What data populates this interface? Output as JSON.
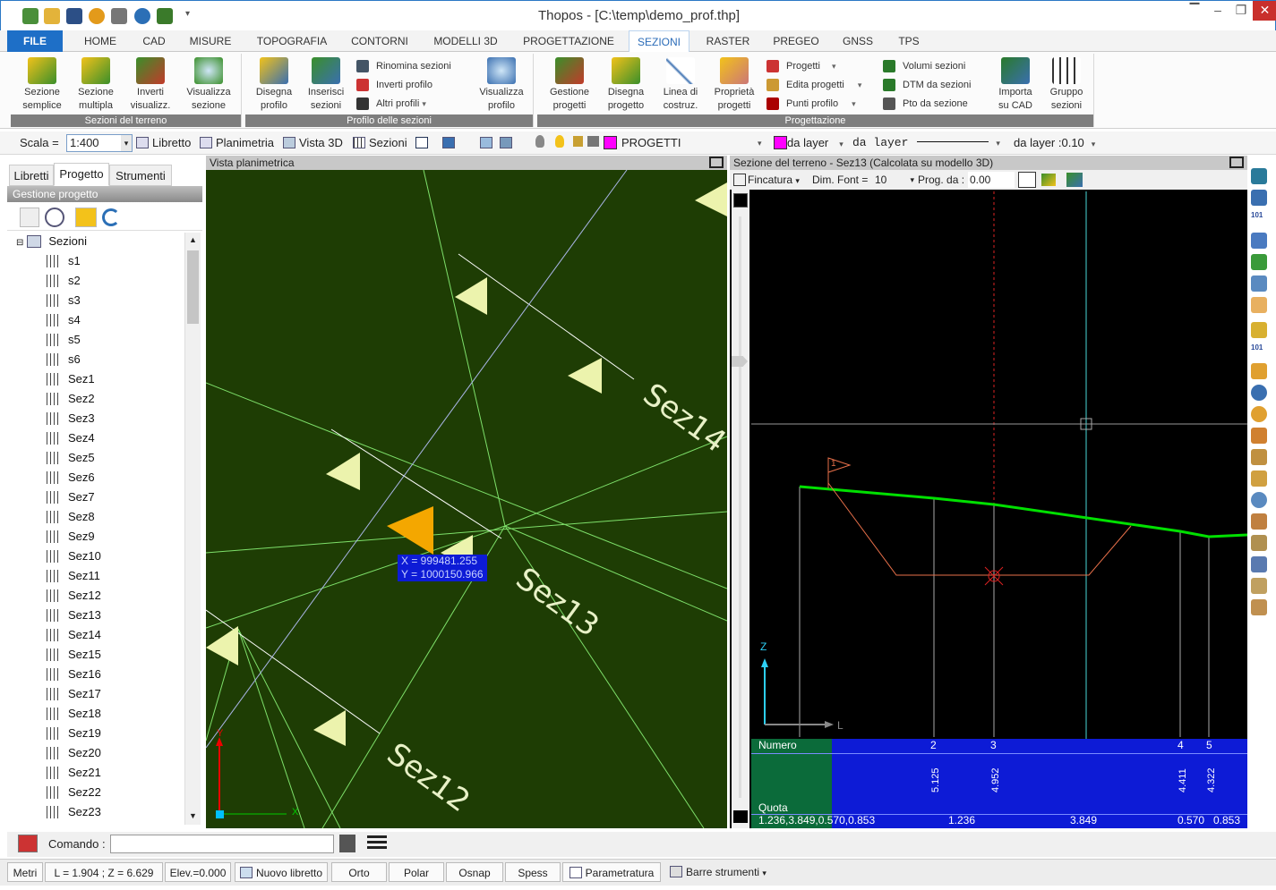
{
  "window": {
    "title": "Thopos - [C:\\temp\\demo_prof.thp]"
  },
  "menu": [
    "FILE",
    "HOME",
    "CAD",
    "MISURE",
    "TOPOGRAFIA",
    "CONTORNI",
    "MODELLI 3D",
    "PROGETTAZIONE",
    "SEZIONI",
    "RASTER",
    "PREGEO",
    "GNSS",
    "TPS"
  ],
  "ribbon": {
    "terreno": {
      "label": "Sezioni del terreno",
      "buttons": [
        [
          "Sezione",
          "semplice"
        ],
        [
          "Sezione",
          "multipla"
        ],
        [
          "Inverti",
          "visualizz."
        ],
        [
          "Visualizza",
          "sezione"
        ]
      ]
    },
    "profilo": {
      "label": "Profilo delle sezioni",
      "buttons": [
        [
          "Disegna",
          "profilo"
        ],
        [
          "Inserisci",
          "sezioni"
        ]
      ],
      "small": [
        "Rinomina sezioni",
        "Inverti profilo",
        "Altri profili"
      ],
      "big2": [
        "Visualizza",
        "profilo"
      ]
    },
    "progettazione": {
      "label": "Progettazione",
      "buttons": [
        [
          "Gestione",
          "progetti"
        ],
        [
          "Disegna",
          "progetto"
        ],
        [
          "Linea di",
          "costruz."
        ],
        [
          "Proprietà",
          "progetti"
        ]
      ],
      "small": [
        "Progetti",
        "Edita progetti",
        "Punti profilo"
      ],
      "small2": [
        "Volumi sezioni",
        "DTM da sezioni",
        "Pto da sezione"
      ],
      "buttons2": [
        [
          "Importa",
          "su CAD"
        ],
        [
          "Gruppo",
          "sezioni"
        ]
      ]
    }
  },
  "toolbar": {
    "scala_label": "Scala =",
    "scala_value": "1:400",
    "libretto": "Libretto",
    "planimetria": "Planimetria",
    "vista3d": "Vista 3D",
    "sezioni": "Sezioni",
    "layer": "PROGETTI",
    "da_layer_color": "da layer",
    "da_layer_line": "da layer",
    "da_layer_width": "da layer :0.10"
  },
  "left_panel": {
    "tabs": [
      "Libretti",
      "Progetto",
      "Strumenti"
    ],
    "title": "Gestione progetto",
    "root": "Sezioni",
    "items": [
      "s1",
      "s2",
      "s3",
      "s4",
      "s5",
      "s6",
      "Sez1",
      "Sez2",
      "Sez3",
      "Sez4",
      "Sez5",
      "Sez6",
      "Sez7",
      "Sez8",
      "Sez9",
      "Sez10",
      "Sez11",
      "Sez12",
      "Sez13",
      "Sez14",
      "Sez15",
      "Sez16",
      "Sez17",
      "Sez18",
      "Sez19",
      "Sez20",
      "Sez21",
      "Sez22",
      "Sez23"
    ]
  },
  "plan_view": {
    "title": "Vista planimetrica",
    "coord_x": "X = 999481.255",
    "coord_y": "Y = 1000150.966",
    "labels": [
      "Sez14",
      "Sez13",
      "Sez12"
    ],
    "axis_x": "X",
    "axis_y": "Y"
  },
  "section_view": {
    "title": "Sezione del terreno - Sez13 (Calcolata su modello 3D)",
    "fincatura": "Fincatura",
    "dim_font_label": "Dim. Font =",
    "dim_font": "10",
    "prog_label": "Prog. da :",
    "prog_value": "0.00",
    "axis_z": "Z",
    "axis_l": "L",
    "flag": "1",
    "table": {
      "numero": "Numero",
      "quota": "Quota",
      "parziali": [
        "1.236",
        "3.849",
        "0.570",
        "0.853"
      ],
      "numbers": [
        "2",
        "3",
        "4",
        "5"
      ],
      "quote": [
        "5.125",
        "4.952",
        "4.411",
        "4.322"
      ]
    }
  },
  "command": {
    "label": "Comando :",
    "value": ""
  },
  "status": {
    "metri": "Metri",
    "lz": "L = 1.904 ; Z = 6.629",
    "elev": "Elev.=0.000",
    "nuovo": "Nuovo libretto",
    "orto": "Orto",
    "polar": "Polar",
    "osnap": "Osnap",
    "spess": "Spess",
    "param": "Parametratura",
    "barre": "Barre strumenti"
  },
  "colors": {
    "accent": "#1e6fc7",
    "plan_bg": "#1e3d04",
    "section_bg": "#000000",
    "table_bg": "#0d1bd6",
    "table_head": "#0b6b3a",
    "profile_green": "#00e000"
  }
}
